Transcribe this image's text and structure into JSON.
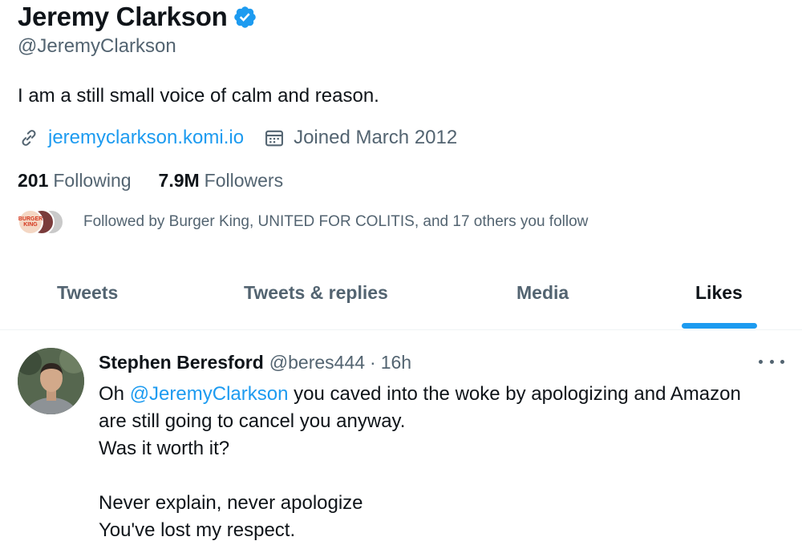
{
  "profile": {
    "name": "Jeremy Clarkson",
    "handle": "@JeremyClarkson",
    "bio": "I am a still small voice of calm and reason.",
    "website": "jeremyclarkson.komi.io",
    "joined": "Joined March 2012",
    "following_count": "201",
    "following_label": "Following",
    "followers_count": "7.9M",
    "followers_label": "Followers",
    "followed_by": "Followed by Burger King, UNITED FOR COLITIS, and 17 others you follow",
    "followed_by_avatar_text": "BURGER KING"
  },
  "tabs": [
    {
      "label": "Tweets",
      "active": false
    },
    {
      "label": "Tweets & replies",
      "active": false
    },
    {
      "label": "Media",
      "active": false
    },
    {
      "label": "Likes",
      "active": true
    }
  ],
  "tweet": {
    "author": "Stephen Beresford",
    "handle": "@beres444",
    "separator": "·",
    "time": "16h",
    "line1_prefix": "Oh ",
    "line1_mention": "@JeremyClarkson",
    "line1_suffix": " you caved into the woke by apologizing and Amazon",
    "line2": "are still going to cancel you anyway.",
    "line3": "Was it worth it?",
    "line5": "Never explain, never apologize",
    "line6": "You've lost my respect."
  },
  "icons": {
    "verified": "verified-badge-icon",
    "link": "link-icon",
    "calendar": "calendar-icon",
    "more": "more-options-icon"
  },
  "colors": {
    "accent": "#1d9bf0",
    "text": "#0f1419",
    "secondary": "#536471"
  }
}
